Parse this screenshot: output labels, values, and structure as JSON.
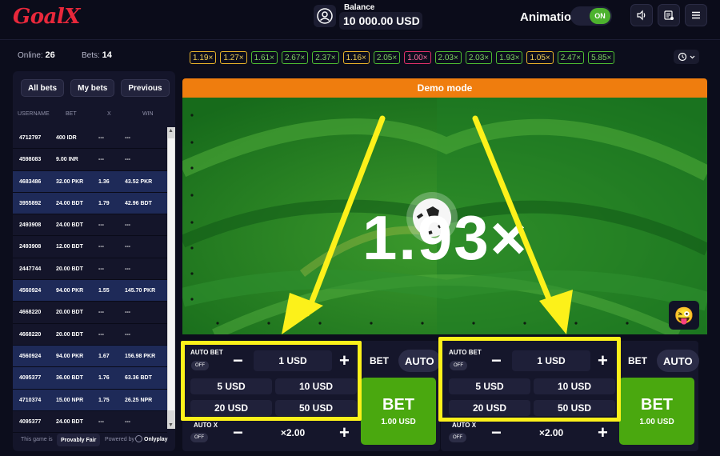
{
  "header": {
    "logo": "GoalX",
    "balance_label": "Balance",
    "balance_value": "10 000.00 USD",
    "animation_label": "Animation",
    "animation_state": "ON"
  },
  "stats": {
    "online_label": "Online:",
    "online_value": "26",
    "bets_label": "Bets:",
    "bets_value": "14"
  },
  "tabs": [
    "All bets",
    "My bets",
    "Previous"
  ],
  "table": {
    "columns": [
      "USERNAME",
      "BET",
      "X",
      "WIN"
    ],
    "rows": [
      {
        "user": "4712797",
        "bet": "400 IDR",
        "x": "---",
        "win": "---",
        "won": false
      },
      {
        "user": "4598083",
        "bet": "9.00 INR",
        "x": "---",
        "win": "---",
        "won": false
      },
      {
        "user": "4683486",
        "bet": "32.00 PKR",
        "x": "1.36",
        "win": "43.52 PKR",
        "won": true
      },
      {
        "user": "3955892",
        "bet": "24.00 BDT",
        "x": "1.79",
        "win": "42.96 BDT",
        "won": true
      },
      {
        "user": "2493908",
        "bet": "24.00 BDT",
        "x": "---",
        "win": "---",
        "won": false
      },
      {
        "user": "2493908",
        "bet": "12.00 BDT",
        "x": "---",
        "win": "---",
        "won": false
      },
      {
        "user": "2447744",
        "bet": "20.00 BDT",
        "x": "---",
        "win": "---",
        "won": false
      },
      {
        "user": "4560924",
        "bet": "94.00 PKR",
        "x": "1.55",
        "win": "145.70 PKR",
        "won": true
      },
      {
        "user": "4668220",
        "bet": "20.00 BDT",
        "x": "---",
        "win": "---",
        "won": false
      },
      {
        "user": "4668220",
        "bet": "20.00 BDT",
        "x": "---",
        "win": "---",
        "won": false
      },
      {
        "user": "4560924",
        "bet": "94.00 PKR",
        "x": "1.67",
        "win": "156.98 PKR",
        "won": true
      },
      {
        "user": "4095377",
        "bet": "36.00 BDT",
        "x": "1.76",
        "win": "63.36 BDT",
        "won": true
      },
      {
        "user": "4710374",
        "bet": "15.00 NPR",
        "x": "1.75",
        "win": "26.25 NPR",
        "won": true
      },
      {
        "user": "4095377",
        "bet": "24.00 BDT",
        "x": "---",
        "win": "---",
        "won": false
      }
    ]
  },
  "footer": {
    "prefix": "This game is",
    "fair": "Provably Fair",
    "powered": "Powered by",
    "brand": "Onlyplay"
  },
  "history": [
    {
      "v": "1.19×",
      "c": "#e6b22a"
    },
    {
      "v": "1.27×",
      "c": "#e6b22a"
    },
    {
      "v": "1.61×",
      "c": "#4dbb32"
    },
    {
      "v": "2.67×",
      "c": "#4dbb32"
    },
    {
      "v": "2.37×",
      "c": "#4dbb32"
    },
    {
      "v": "1.16×",
      "c": "#e6b22a"
    },
    {
      "v": "2.05×",
      "c": "#4dbb32"
    },
    {
      "v": "1.00×",
      "c": "#e0306a"
    },
    {
      "v": "2.03×",
      "c": "#4dbb32"
    },
    {
      "v": "2.03×",
      "c": "#4dbb32"
    },
    {
      "v": "1.93×",
      "c": "#4dbb32"
    },
    {
      "v": "1.05×",
      "c": "#e6b22a"
    },
    {
      "v": "2.47×",
      "c": "#4dbb32"
    },
    {
      "v": "5.85×",
      "c": "#4dbb32"
    }
  ],
  "game": {
    "demo_label": "Demo mode",
    "multiplier": "1.93×"
  },
  "bet_panels": [
    {
      "auto_bet_label": "AUTO BET",
      "auto_bet_state": "OFF",
      "amount": "1 USD",
      "quick": [
        "5 USD",
        "10 USD",
        "20 USD",
        "50 USD"
      ],
      "mode_bet": "BET",
      "mode_auto": "AUTO",
      "bet_label": "BET",
      "bet_amount": "1.00 USD",
      "auto_x_label": "AUTO X",
      "auto_x_state": "OFF",
      "auto_x_value": "×2.00"
    },
    {
      "auto_bet_label": "AUTO BET",
      "auto_bet_state": "OFF",
      "amount": "1 USD",
      "quick": [
        "5 USD",
        "10 USD",
        "20 USD",
        "50 USD"
      ],
      "mode_bet": "BET",
      "mode_auto": "AUTO",
      "bet_label": "BET",
      "bet_amount": "1.00 USD",
      "auto_x_label": "AUTO X",
      "auto_x_state": "OFF",
      "auto_x_value": "×2.00"
    }
  ],
  "colors": {
    "accent": "#4aa80f",
    "demo": "#ef7d0e",
    "highlight": "#fcf11a",
    "logo": "#e8283b"
  }
}
